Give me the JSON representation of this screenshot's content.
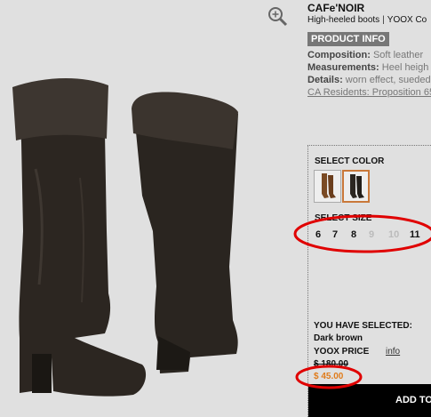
{
  "product": {
    "brand": "CAFe'NOIR",
    "category": "High-heeled boots",
    "source": "YOOX Co",
    "tab_label": "PRODUCT INFO",
    "composition_label": "Composition:",
    "composition_value": " Soft leather",
    "measurements_label": "Measurements:",
    "measurements_value": " Heel heigh",
    "details_label": "Details:",
    "details_value": " worn effect, sueded",
    "prop65": "CA Residents: Proposition 65"
  },
  "selection": {
    "color_label": "SELECT COLOR",
    "size_label": "SELECT SIZE",
    "sizes": [
      {
        "label": "6",
        "available": true
      },
      {
        "label": "7",
        "available": true
      },
      {
        "label": "8",
        "available": true
      },
      {
        "label": "9",
        "available": false
      },
      {
        "label": "10",
        "available": false
      },
      {
        "label": "11",
        "available": true
      }
    ],
    "you_selected": "YOU HAVE SELECTED:",
    "color_name": "Dark brown",
    "price_label": "YOOX PRICE",
    "info_link": "info",
    "old_price": "$ 180.00",
    "new_price": "$ 45.00",
    "add_button": "ADD TO"
  },
  "colors": {
    "boot": "#2f2a25",
    "boot_light": "#4a423b",
    "swatch_brown": "#7a4a24",
    "accent": "#e07b1a",
    "annotation": "#e00000"
  }
}
